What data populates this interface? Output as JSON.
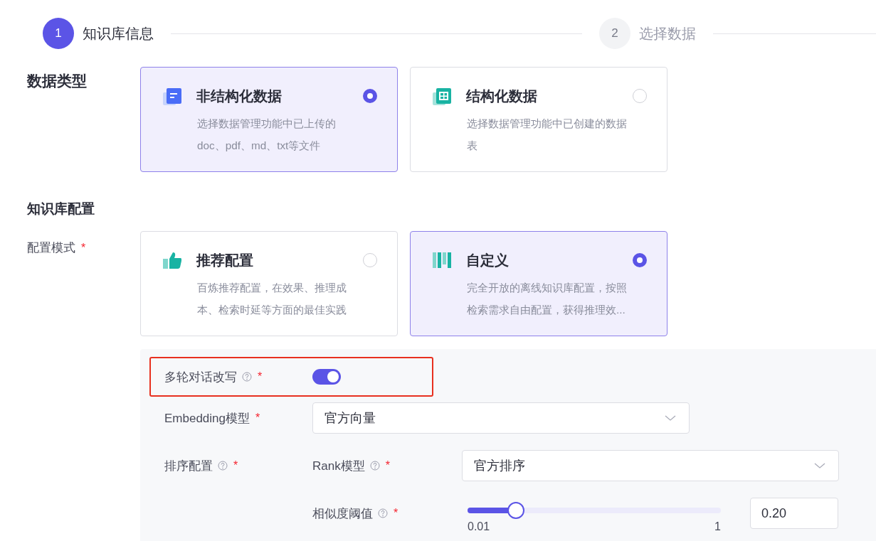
{
  "steps": [
    {
      "number": "1",
      "label": "知识库信息",
      "active": true
    },
    {
      "number": "2",
      "label": "选择数据",
      "active": false
    }
  ],
  "data_type": {
    "label": "数据类型",
    "options": [
      {
        "title": "非结构化数据",
        "description": "选择数据管理功能中已上传的doc、pdf、md、txt等文件",
        "selected": true
      },
      {
        "title": "结构化数据",
        "description": "选择数据管理功能中已创建的数据表",
        "selected": false
      }
    ]
  },
  "config_heading": "知识库配置",
  "config_mode": {
    "label": "配置模式",
    "required_mark": "*",
    "options": [
      {
        "title": "推荐配置",
        "description": "百炼推荐配置，在效果、推理成本、检索时延等方面的最佳实践",
        "selected": false
      },
      {
        "title": "自定义",
        "description": "完全开放的离线知识库配置，按照检索需求自由配置，获得推理效...",
        "selected": true
      }
    ]
  },
  "custom_panel": {
    "rewrite": {
      "label": "多轮对话改写",
      "help": true,
      "required_mark": "*",
      "on": true,
      "highlighted": true
    },
    "embedding": {
      "label": "Embedding模型",
      "required_mark": "*",
      "value": "官方向量"
    },
    "ranking": {
      "label": "排序配置",
      "help": true,
      "required_mark": "*",
      "rank_model": {
        "label": "Rank模型",
        "help": true,
        "required_mark": "*",
        "value": "官方排序"
      },
      "similarity": {
        "label": "相似度阈值",
        "help": true,
        "required_mark": "*",
        "level": 0.19,
        "value": "0.20",
        "min_label": "0.01",
        "max_label": "1"
      }
    }
  }
}
